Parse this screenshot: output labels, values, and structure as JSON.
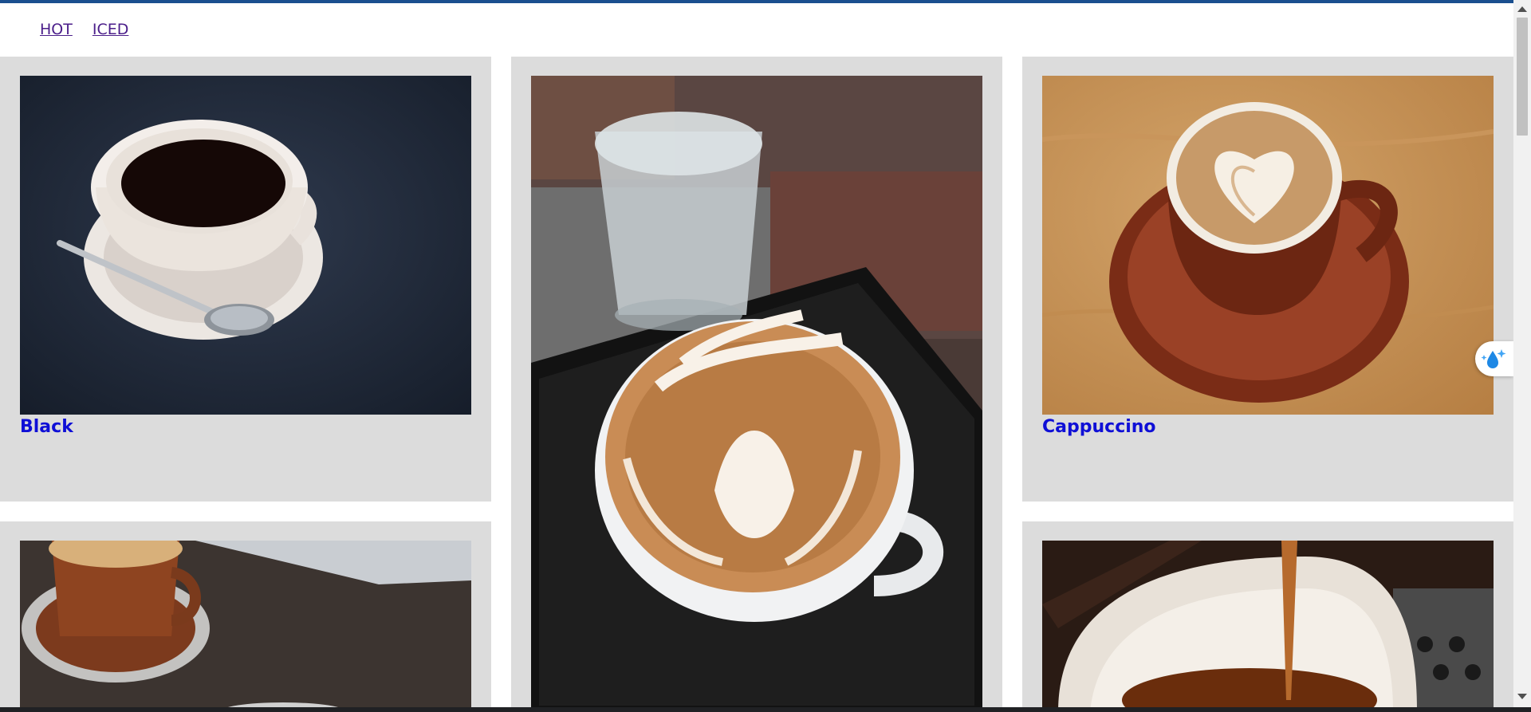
{
  "nav": {
    "items": [
      {
        "label": "HOT"
      },
      {
        "label": "ICED"
      }
    ]
  },
  "cards": [
    {
      "title": "Black",
      "image": "black-coffee-photo"
    },
    {
      "title": "",
      "image": "latte-art-photo"
    },
    {
      "title": "Cappuccino",
      "image": "cappuccino-photo"
    },
    {
      "title": "",
      "image": "espresso-cup-photo"
    },
    {
      "title": "",
      "image": "espresso-pour-photo"
    }
  ],
  "colors": {
    "topbar": "#1a4f8f",
    "card_bg": "#dcdcdc",
    "title_link": "#0f0fd6",
    "nav_link": "#4b1e8a"
  }
}
